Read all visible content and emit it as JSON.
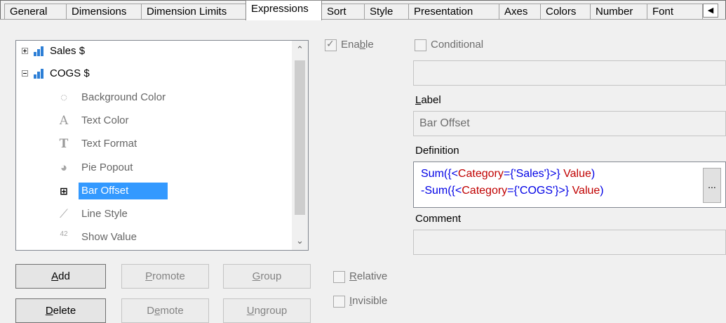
{
  "tabs": [
    {
      "label": "General"
    },
    {
      "label": "Dimensions"
    },
    {
      "label": "Dimension Limits"
    },
    {
      "label": "Expressions"
    },
    {
      "label": "Sort"
    },
    {
      "label": "Style"
    },
    {
      "label": "Presentation"
    },
    {
      "label": "Axes"
    },
    {
      "label": "Colors"
    },
    {
      "label": "Number"
    },
    {
      "label": "Font"
    }
  ],
  "active_tab": "Expressions",
  "tree": {
    "expressions": [
      {
        "label": "Sales $",
        "expanded": false
      },
      {
        "label": "COGS $",
        "expanded": true
      }
    ],
    "attributes": [
      {
        "label": "Background Color",
        "icon": "palette-icon"
      },
      {
        "label": "Text Color",
        "icon": "text-color-icon"
      },
      {
        "label": "Text Format",
        "icon": "text-format-icon"
      },
      {
        "label": "Pie Popout",
        "icon": "pie-icon"
      },
      {
        "label": "Bar Offset",
        "icon": "bar-offset-icon",
        "selected": true
      },
      {
        "label": "Line Style",
        "icon": "line-style-icon"
      },
      {
        "label": "Show Value",
        "icon": "show-value-icon"
      }
    ],
    "show_value_glyph": "42"
  },
  "buttons": {
    "add": {
      "accel": "A",
      "rest": "dd"
    },
    "promote": {
      "accel": "P",
      "rest": "romote"
    },
    "group": {
      "accel": "G",
      "rest": "roup"
    },
    "delete": {
      "accel": "D",
      "rest": "elete"
    },
    "demote_pre": "D",
    "demote_accel": "e",
    "demote_post": "mote",
    "ungroup": {
      "accel": "U",
      "rest": "ngroup"
    }
  },
  "checks": {
    "enable_pre": "Ena",
    "enable_accel": "b",
    "enable_post": "le",
    "enable_checked": true,
    "conditional": "Conditional",
    "relative_accel": "R",
    "relative_rest": "elative",
    "invisible_accel": "I",
    "invisible_rest": "nvisible"
  },
  "label_section": {
    "heading_accel": "L",
    "heading_rest": "abel",
    "value": "Bar Offset"
  },
  "definition": {
    "heading": "Definition",
    "line1": {
      "a": "Sum({<",
      "b": "Category",
      "c": "={'Sales'}>} ",
      "d": "Value",
      "e": ")"
    },
    "line2": {
      "a": "-Sum({<",
      "b": "Category",
      "c": "={'COGS'}>} ",
      "d": "Value",
      "e": ")"
    },
    "ellipsis": "..."
  },
  "comment": {
    "heading": "Comment"
  }
}
